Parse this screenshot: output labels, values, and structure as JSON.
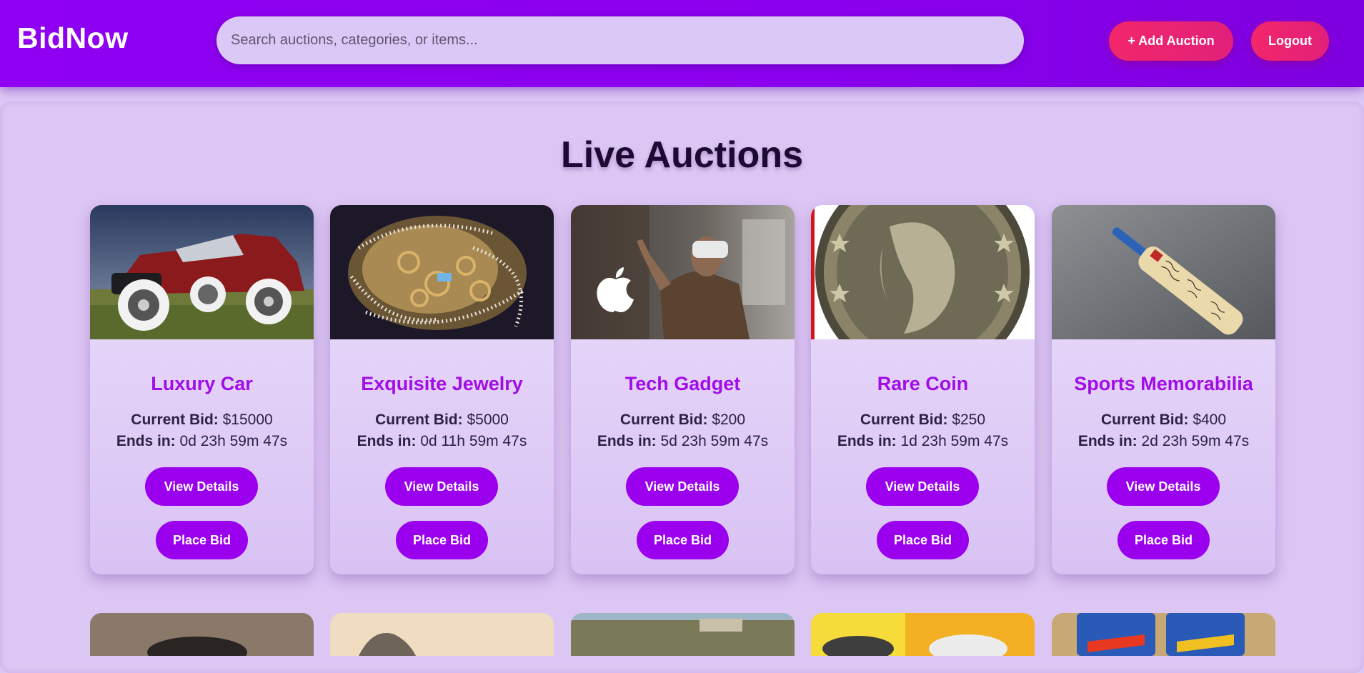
{
  "header": {
    "brand": "BidNow",
    "search_placeholder": "Search auctions, categories, or items...",
    "add_auction_label": "+ Add Auction",
    "logout_label": "Logout"
  },
  "main": {
    "title": "Live Auctions",
    "labels": {
      "current_bid": "Current Bid:",
      "ends_in": "Ends in:",
      "view_details": "View Details",
      "place_bid": "Place Bid"
    },
    "auctions": [
      {
        "title": "Luxury Car",
        "current_bid": "$15000",
        "ends_in": "0d 23h 59m 47s",
        "image": "vintage red roadster car"
      },
      {
        "title": "Exquisite Jewelry",
        "current_bid": "$5000",
        "ends_in": "0d 11h 59m 47s",
        "image": "pile of gold chains and pearls"
      },
      {
        "title": "Tech Gadget",
        "current_bid": "$200",
        "ends_in": "5d 23h 59m 47s",
        "image": "man wearing VR headset with apple logo"
      },
      {
        "title": "Rare Coin",
        "current_bid": "$250",
        "ends_in": "1d 23h 59m 47s",
        "image": "antique silver coin with liberty bust"
      },
      {
        "title": "Sports Memorabilia",
        "current_bid": "$400",
        "ends_in": "2d 23h 59m 47s",
        "image": "signed cricket bat"
      }
    ],
    "second_row_images": [
      "dark object",
      "sculpture",
      "coastal town",
      "smart speaker devices",
      "toy cars packaging"
    ]
  },
  "colors": {
    "header": "#8f00f2",
    "accent_pink": "#f2276a",
    "button_purple": "#9b00ee",
    "title_purple": "#a10de8",
    "background": "#dcc8f6"
  }
}
